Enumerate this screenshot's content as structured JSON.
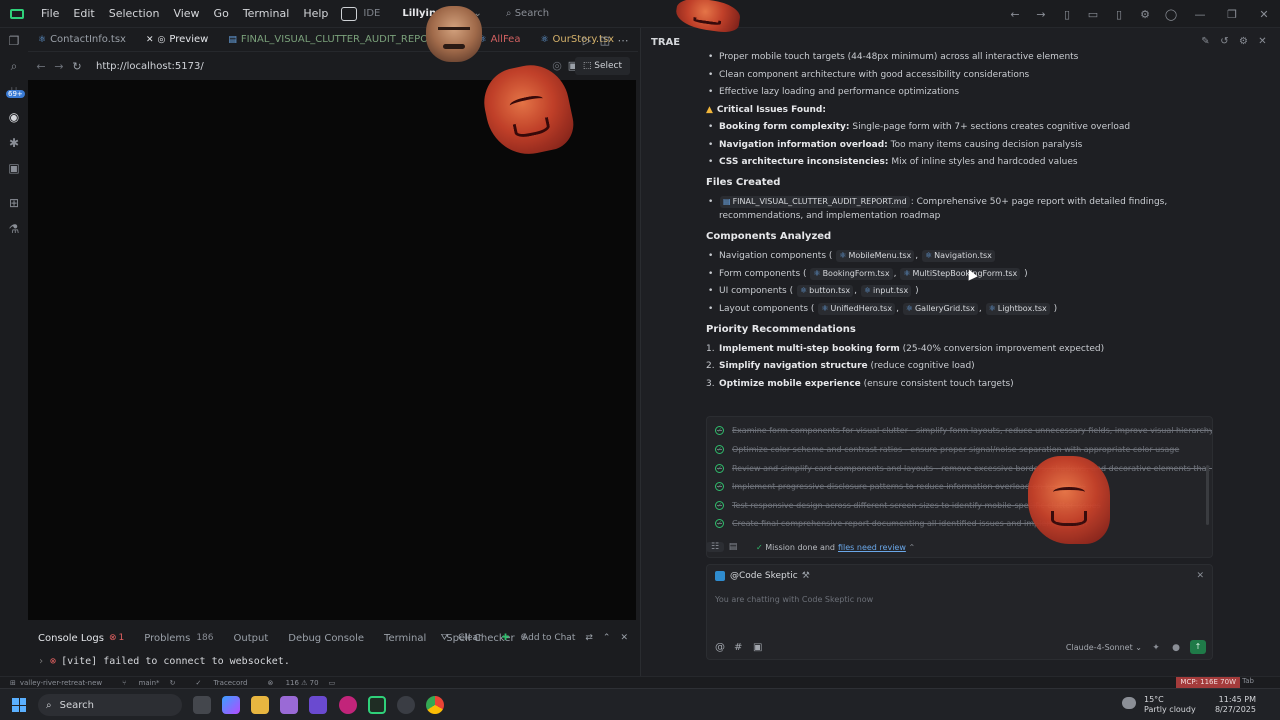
{
  "titlebar": {
    "menu": [
      "File",
      "Edit",
      "Selection",
      "View",
      "Go",
      "Terminal",
      "Help"
    ],
    "ide_label": "IDE",
    "project": "Lillyinvalley",
    "search_placeholder": "Search"
  },
  "editor": {
    "tabs": [
      {
        "label": "ContactInfo.tsx",
        "icon": "react-icon"
      },
      {
        "label": "Preview",
        "icon": "eye-icon"
      },
      {
        "label": "FINAL_VISUAL_CLUTTER_AUDIT_REPORT.md",
        "icon": "markdown-icon"
      },
      {
        "label": "AllFea",
        "icon": "react-icon"
      },
      {
        "label": "OurStory.tsx",
        "icon": "react-icon"
      }
    ],
    "url": "http://localhost:5173/",
    "select_label": "Select"
  },
  "activity_badge": "69+",
  "panel": {
    "tabs": [
      {
        "label": "Console Logs",
        "count": "1"
      },
      {
        "label": "Problems",
        "count": "186"
      },
      {
        "label": "Output",
        "count": ""
      },
      {
        "label": "Debug Console",
        "count": ""
      },
      {
        "label": "Terminal",
        "count": ""
      },
      {
        "label": "Spell Checker",
        "count": "6"
      }
    ],
    "clear_label": "Clear",
    "add_to_chat_label": "Add to Chat",
    "console_line": "[vite] failed to connect to websocket."
  },
  "chat": {
    "title": "TRAE",
    "strengths": [
      "Proper mobile touch targets (44-48px minimum) across all interactive elements",
      "Clean component architecture with good accessibility considerations",
      "Effective lazy loading and performance optimizations"
    ],
    "critical_heading": "Critical Issues Found:",
    "critical": [
      {
        "bold": "Booking form complexity:",
        "text": " Single-page form with 7+ sections creates cognitive overload"
      },
      {
        "bold": "Navigation information overload:",
        "text": " Too many items causing decision paralysis"
      },
      {
        "bold": "CSS architecture inconsistencies:",
        "text": " Mix of inline styles and hardcoded values"
      }
    ],
    "files_heading": "Files Created",
    "file_chip": "FINAL_VISUAL_CLUTTER_AUDIT_REPORT.md",
    "file_desc": ": Comprehensive 50+ page report with detailed findings, recommendations, and implementation roadmap",
    "components_heading": "Components Analyzed",
    "components": [
      {
        "label": "Navigation components (",
        "chips": [
          "MobileMenu.tsx",
          "Navigation.tsx"
        ],
        "close": ""
      },
      {
        "label": "Form components (",
        "chips": [
          "BookingForm.tsx",
          "MultiStepBookingForm.tsx"
        ],
        "close": ")"
      },
      {
        "label": "UI components (",
        "chips": [
          "button.tsx",
          "input.tsx"
        ],
        "close": ")"
      },
      {
        "label": "Layout components (",
        "chips": [
          "UnifiedHero.tsx",
          "GalleryGrid.tsx",
          "Lightbox.tsx"
        ],
        "close": ")"
      }
    ],
    "priority_heading": "Priority Recommendations",
    "priorities": [
      {
        "num": "1.",
        "bold": "Implement multi-step booking form",
        "text": " (25-40% conversion improvement expected)"
      },
      {
        "num": "2.",
        "bold": "Simplify navigation structure",
        "text": " (reduce cognitive load)"
      },
      {
        "num": "3.",
        "bold": "Optimize mobile experience",
        "text": " (ensure consistent touch targets)"
      }
    ],
    "tasks": [
      "Examine form components for visual clutter - simplify form layouts, reduce unnecessary fields, improve visual hierarchy",
      "Optimize color scheme and contrast ratios - ensure proper signal/noise separation with appropriate color usage",
      "Review and simplify card components and layouts - remove excessive borders, shadows, and decorative elements that don't serve u",
      "Implement progressive disclosure patterns to reduce information overload on key pages",
      "Test responsive design across different screen sizes to identify mobile-specific clutter issues",
      "Create final comprehensive report documenting all identified issues and implementation"
    ],
    "mission_text": "Mission done and",
    "mission_link": "files need review",
    "agent": "@Code Skeptic",
    "placeholder": "You are chatting with Code Skeptic now",
    "model": "Claude-4-Sonnet"
  },
  "statusbar": {
    "branch_repo": "valley-river-retreat-new",
    "branch": "main*",
    "tracecord": "Tracecord",
    "counts": "116 ⚠ 70",
    "mcp": "MCP: 116E 70W",
    "tab": "Tab"
  },
  "taskbar": {
    "search": "Search",
    "temp": "15°C",
    "weather": "Partly cloudy",
    "time": "11:45 PM",
    "date": "8/27/2025"
  }
}
